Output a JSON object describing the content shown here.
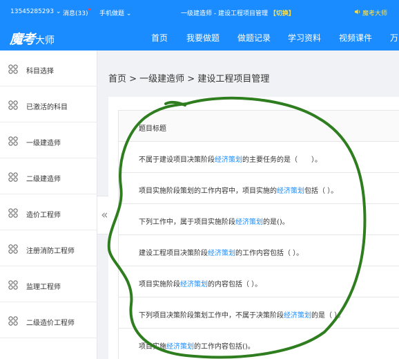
{
  "topbar": {
    "phone": "13545285293 ⌄",
    "messages": "消息(33)",
    "mobile": "手机做题 ⌄",
    "subject_prefix": "一级建造师 - 建设工程项目管理",
    "switch_label": "【切换】",
    "right_text": "魔考大师"
  },
  "nav": {
    "logo_brand": "魔考",
    "logo_suffix": "大师",
    "items": [
      "首页",
      "我要做题",
      "做题记录",
      "学习资料",
      "视频课件",
      "万"
    ]
  },
  "sidebar": {
    "items": [
      {
        "label": "科目选择"
      },
      {
        "label": "已激活的科目"
      },
      {
        "label": "一级建造师"
      },
      {
        "label": "二级建造师"
      },
      {
        "label": "造价工程师"
      },
      {
        "label": "注册消防工程师"
      },
      {
        "label": "监理工程师"
      },
      {
        "label": "二级造价工程师"
      }
    ],
    "collapse_glyph": "«"
  },
  "breadcrumb": "首页 > 一级建造师 > 建设工程项目管理",
  "table": {
    "header": "题目标题",
    "keyword": "经济策划",
    "rows": [
      {
        "before": "不属于建设项目决策阶段",
        "after": "的主要任务的是（　　）。"
      },
      {
        "before": "项目实施阶段策划的工作内容中，项目实施的",
        "after": "包括（ ）。"
      },
      {
        "before": "下列工作中，属于项目实施阶段",
        "after": "的是()。"
      },
      {
        "before": "建设工程项目决策阶段",
        "after": "的工作内容包括（ ）。"
      },
      {
        "before": "项目实施阶段",
        "after": "的内容包括（ ）。"
      },
      {
        "before": "下列项目决策阶段策划工作中，不属于决策阶段",
        "after": "的是（ ）。"
      },
      {
        "before": "项目实施",
        "after": "的工作内容包括()。"
      }
    ]
  },
  "colors": {
    "brand_blue": "#1a8cff",
    "link_blue": "#1a8cff",
    "annotation_green": "#2e7d1e",
    "switch_yellow": "#ffe14a"
  },
  "icons": {
    "sidebar": "four-circles-icon",
    "speaker": "speaker-icon",
    "collapse": "double-chevron-left-icon"
  }
}
